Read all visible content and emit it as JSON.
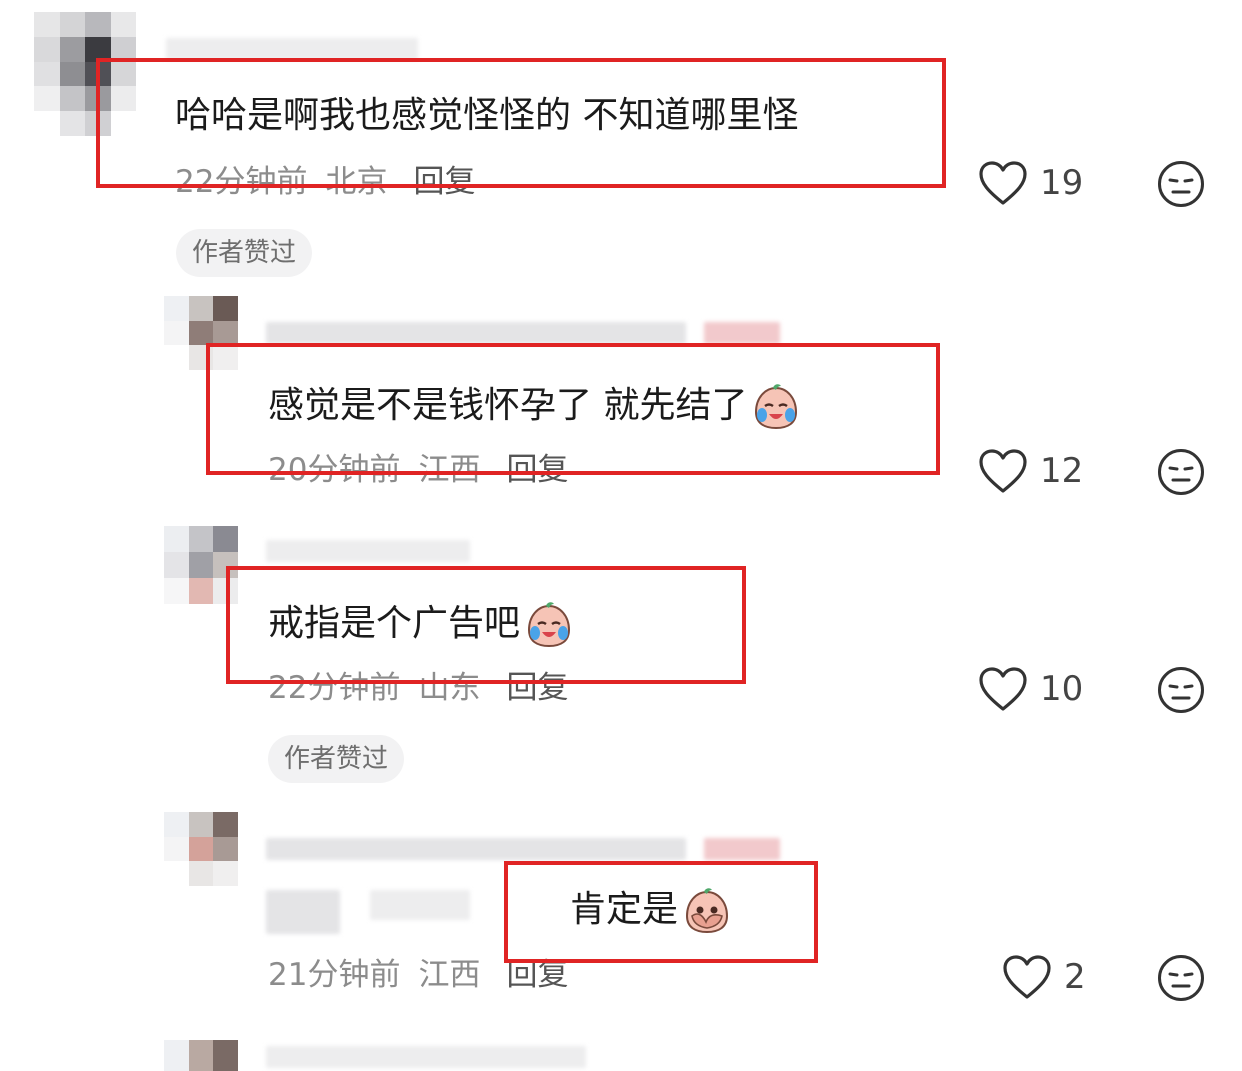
{
  "comments": [
    {
      "text": "哈哈是啊我也感觉怪怪的 不知道哪里怪",
      "time": "22分钟前",
      "region": "北京",
      "reply": "回复",
      "likes": "19",
      "badge": "作者赞过"
    },
    {
      "text": "感觉是不是钱怀孕了 就先结了",
      "time": "20分钟前",
      "region": "江西",
      "reply": "回复",
      "likes": "12"
    },
    {
      "text": "戒指是个广告吧",
      "time": "22分钟前",
      "region": "山东",
      "reply": "回复",
      "likes": "10",
      "badge": "作者赞过"
    },
    {
      "text": "肯定是",
      "time": "21分钟前",
      "region": "江西",
      "reply": "回复",
      "likes": "2"
    }
  ],
  "icons": {
    "like": "heart-outline-icon",
    "dislike": "meh-face-icon",
    "emoji_cry": "crying-face-emoji",
    "emoji_shy": "covering-face-emoji"
  },
  "colors": {
    "highlight_box": "#e02424",
    "meta_text": "#8c8c8c",
    "badge_bg": "#f2f2f3"
  }
}
